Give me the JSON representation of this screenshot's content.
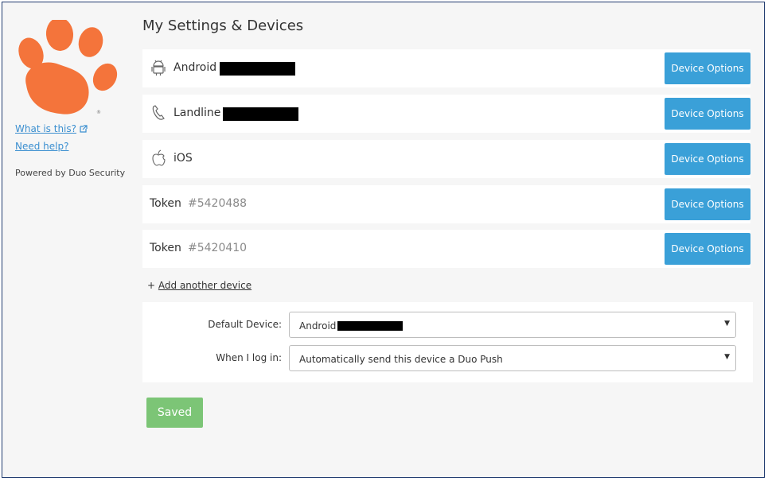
{
  "page": {
    "title": "My Settings & Devices"
  },
  "sidebar": {
    "what_is_this": "What is this?",
    "need_help": "Need help?",
    "powered_by": "Powered by Duo Security"
  },
  "devices": [
    {
      "type": "android",
      "icon": "android-icon",
      "name": "Android",
      "number": "",
      "button": "Device Options"
    },
    {
      "type": "landline",
      "icon": "phone-icon",
      "name": "Landline",
      "number": "",
      "button": "Device Options"
    },
    {
      "type": "ios",
      "icon": "apple-icon",
      "name": "iOS",
      "number": "",
      "button": "Device Options"
    },
    {
      "type": "token",
      "icon": "",
      "name": "Token",
      "number": "#5420488",
      "button": "Device Options"
    },
    {
      "type": "token",
      "icon": "",
      "name": "Token",
      "number": "#5420410",
      "button": "Device Options"
    }
  ],
  "add_device": {
    "prefix": "+",
    "label": "Add another device"
  },
  "settings": {
    "default_device_label": "Default Device:",
    "default_device_value": "Android",
    "login_label": "When I log in:",
    "login_value": "Automatically send this device a Duo Push"
  },
  "saved_button": "Saved",
  "colors": {
    "primary_button": "#3aa0d8",
    "saved_button": "#7cc576",
    "logo": "#f4743b",
    "link": "#3b8fd0"
  }
}
